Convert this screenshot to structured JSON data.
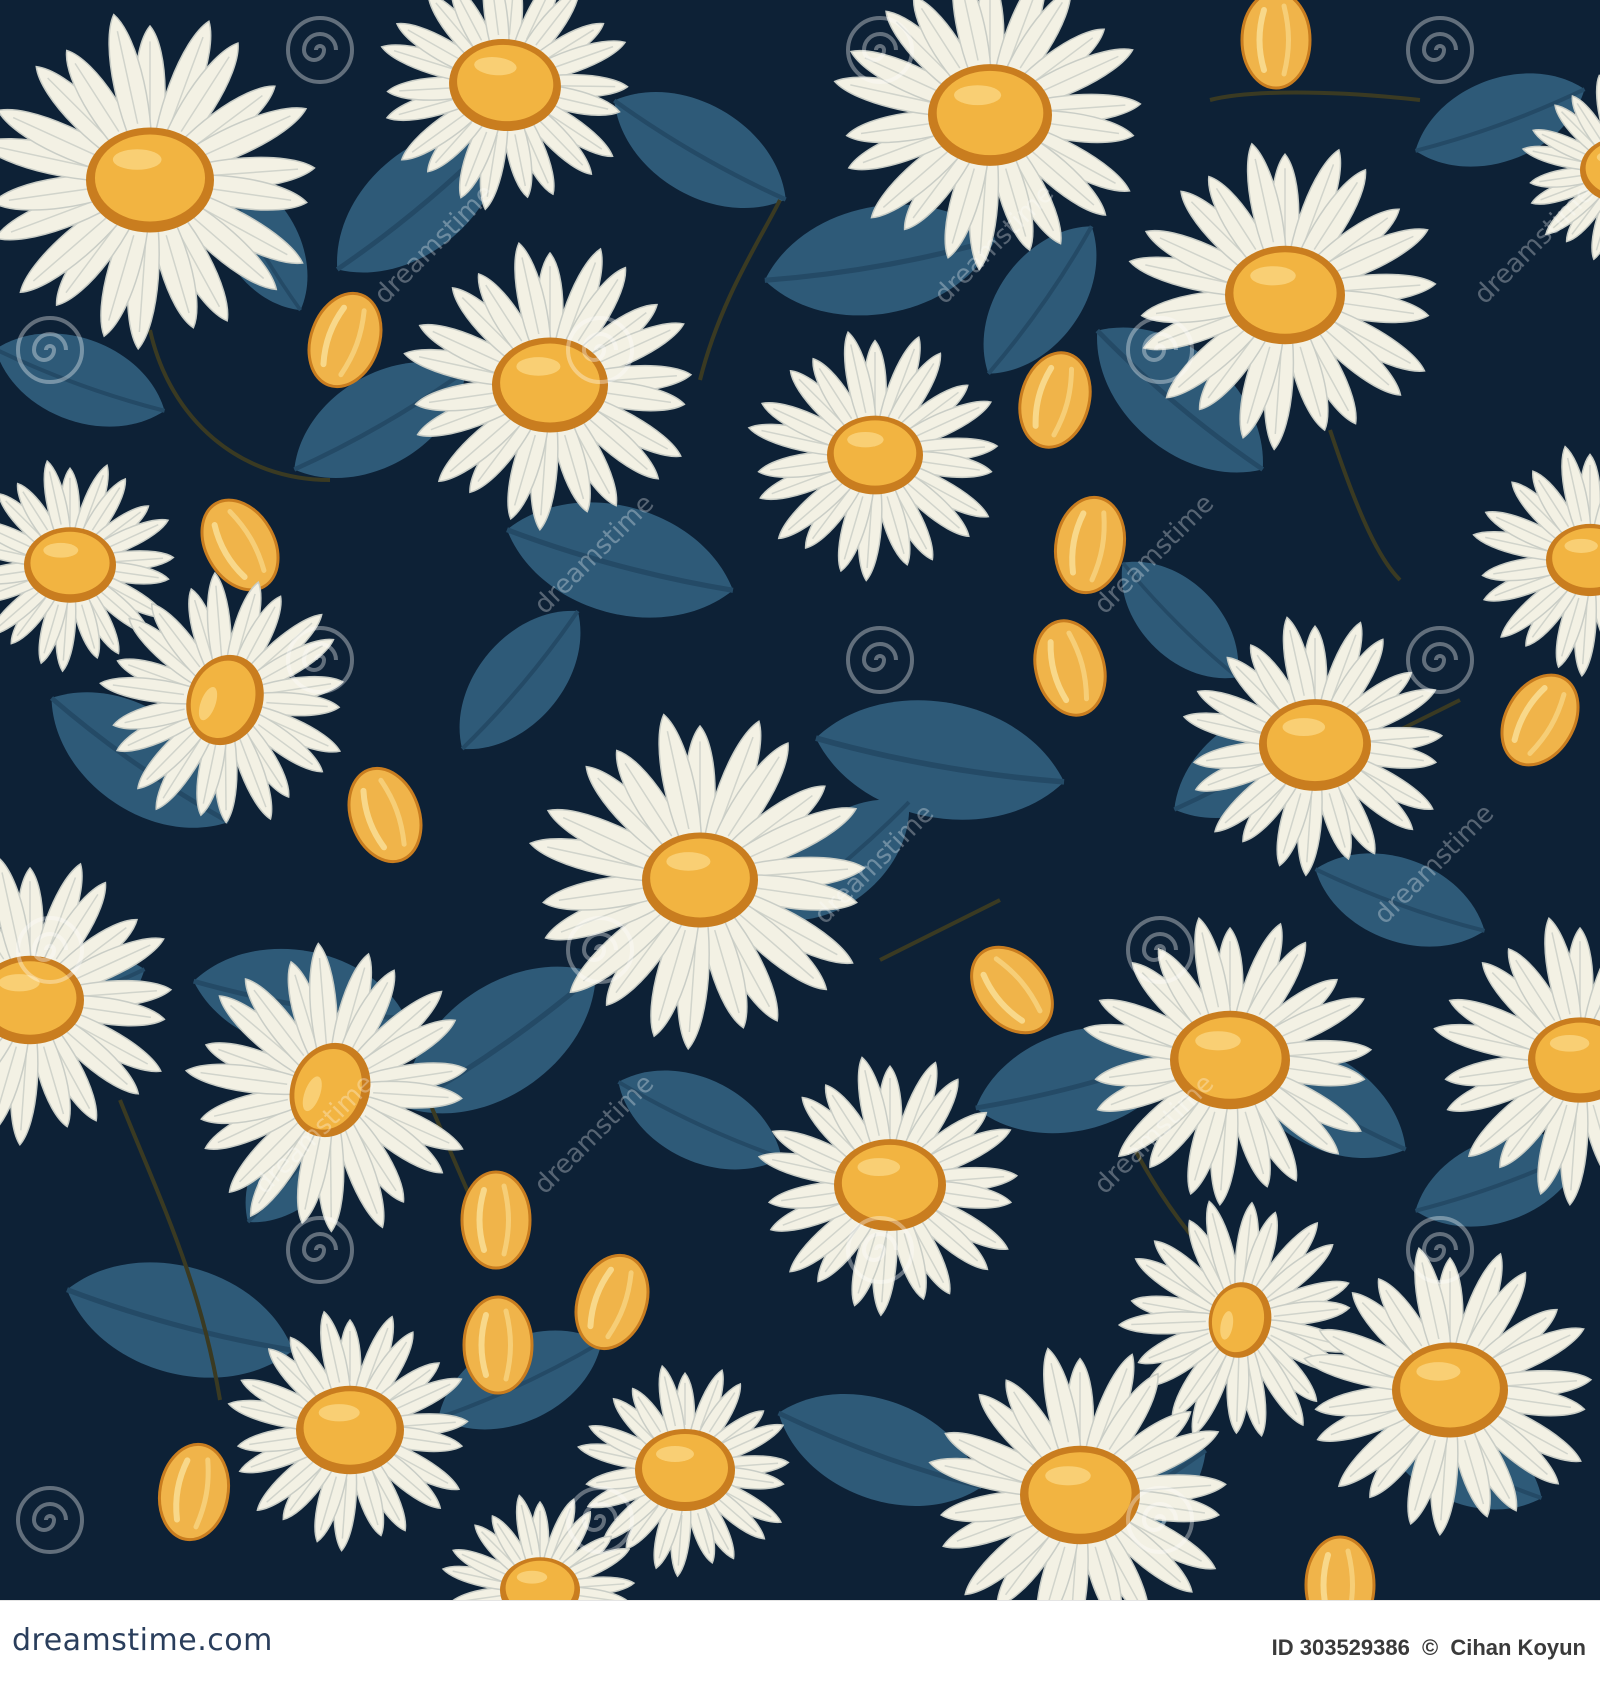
{
  "image": {
    "subject": "seamless daisy pattern",
    "colors": {
      "background": "#0d2136",
      "leaf": "#2e5a78",
      "leaf_dark": "#244a66",
      "petal": "#f3f1e4",
      "petal_shadow": "#c9cdc6",
      "center": "#f2b441",
      "center_rim": "#c97d1f",
      "bud": "#f0b44a",
      "stem": "#3a3a22"
    },
    "watermark": {
      "text": "dreamstime",
      "icon": "spiral-logo-icon"
    }
  },
  "footer": {
    "brand": "dreamstime.com",
    "id_label": "ID 303529386",
    "copyright_symbol": "©",
    "author": "Cihan Koyun"
  }
}
